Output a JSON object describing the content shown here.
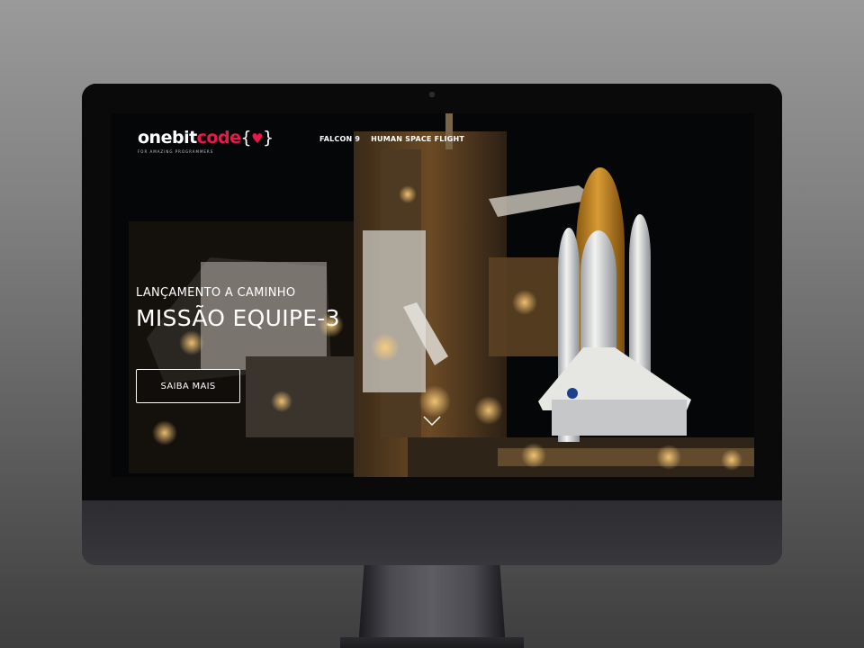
{
  "site": {
    "logo": {
      "part_one": "onebit",
      "part_two": "code",
      "brace_open": "{",
      "brace_close": "}",
      "heart_glyph": "♥",
      "tagline": "FOR AMAZING PROGRAMMERS"
    },
    "nav": {
      "links": [
        {
          "label": "FALCON 9"
        },
        {
          "label": "HUMAN SPACE FLIGHT"
        }
      ]
    },
    "hero": {
      "kicker": "LANÇAMENTO A CAMINHO",
      "title": "MISSÃO EQUIPE-3",
      "cta_label": "SAIBA MAIS",
      "scroll_icon": "chevron-down-icon"
    }
  },
  "device": {
    "type": "iMac",
    "logo_icon": "apple-logo-icon"
  },
  "colors": {
    "brand_accent": "#e8194a",
    "hero_text": "#ffffff",
    "screen_background": "#050607",
    "bezel": "#0a0a0b",
    "chin": "#333337"
  }
}
